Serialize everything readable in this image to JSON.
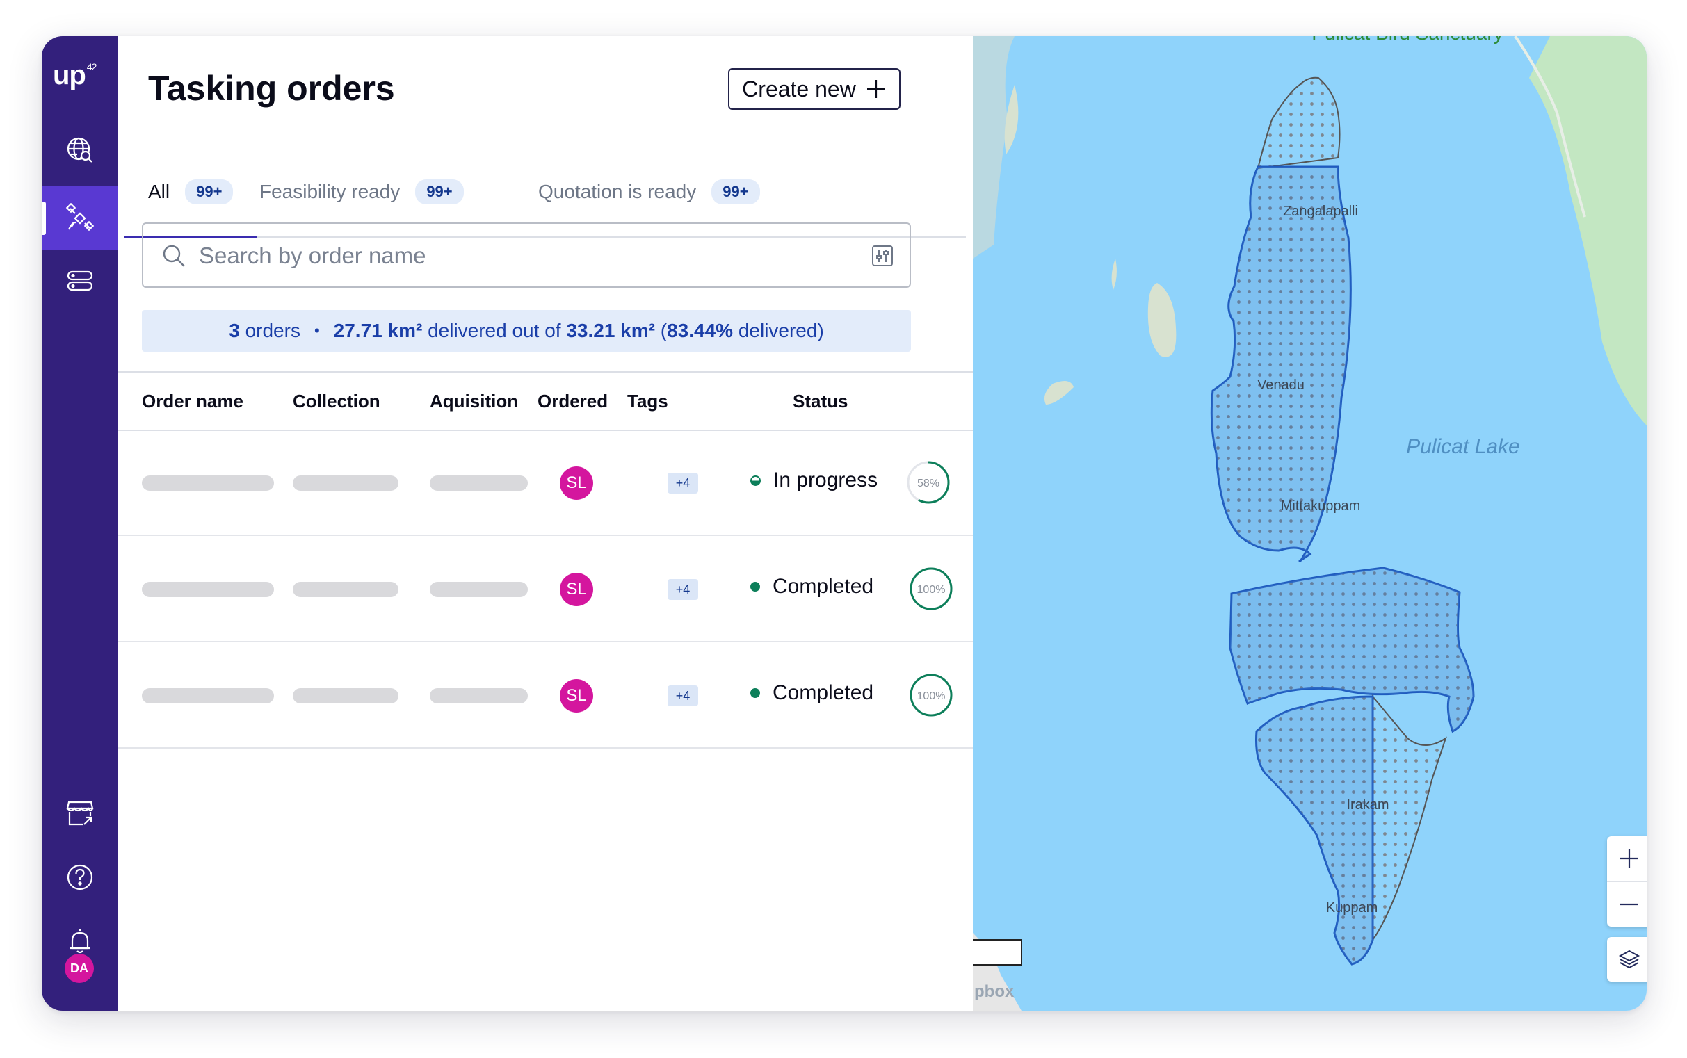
{
  "sidebar": {
    "logo": "up",
    "logo_sup": "42",
    "user_initials": "DA"
  },
  "header": {
    "title": "Tasking orders",
    "create_label": "Create new"
  },
  "tabs": [
    {
      "label": "All",
      "badge": "99+"
    },
    {
      "label": "Feasibility ready",
      "badge": "99+"
    },
    {
      "label": "Quotation is ready",
      "badge": "99+"
    }
  ],
  "search": {
    "placeholder": "Search by order name"
  },
  "summary": {
    "count": "3",
    "count_label": "orders",
    "delivered": "27.71 km²",
    "delivered_label": "delivered out of",
    "total": "33.21 km²",
    "pct_open": "(",
    "percent": "83.44%",
    "pct_close": "delivered)"
  },
  "table": {
    "columns": [
      "Order name",
      "Collection",
      "Aquisition",
      "Ordered",
      "Tags",
      "Status"
    ],
    "rows": [
      {
        "ordered_by": "SL",
        "tags": "+4",
        "status": "In progress",
        "progress_label": "58%",
        "progress": 0.58
      },
      {
        "ordered_by": "SL",
        "tags": "+4",
        "status": "Completed",
        "progress_label": "100%",
        "progress": 1.0
      },
      {
        "ordered_by": "SL",
        "tags": "+4",
        "status": "Completed",
        "progress_label": "100%",
        "progress": 1.0
      }
    ]
  },
  "map": {
    "labels": {
      "sanctuary": "Pulicat Bird Sanctuary",
      "lake": "Pulicat Lake",
      "place1": "Zangalapalli",
      "place2": "Venadu",
      "place3": "Mittakuppam",
      "place4": "Irakam",
      "place5": "Kuppam",
      "attribution": "pbox"
    },
    "zoom_in": "+",
    "zoom_out": "—"
  },
  "colors": {
    "sidebar": "#33207c",
    "sidebar_active": "#5939d2",
    "accent": "#1a3ea8",
    "status_green": "#0d7f5a",
    "avatar": "#d4169e",
    "water": "#8fd3fb"
  }
}
